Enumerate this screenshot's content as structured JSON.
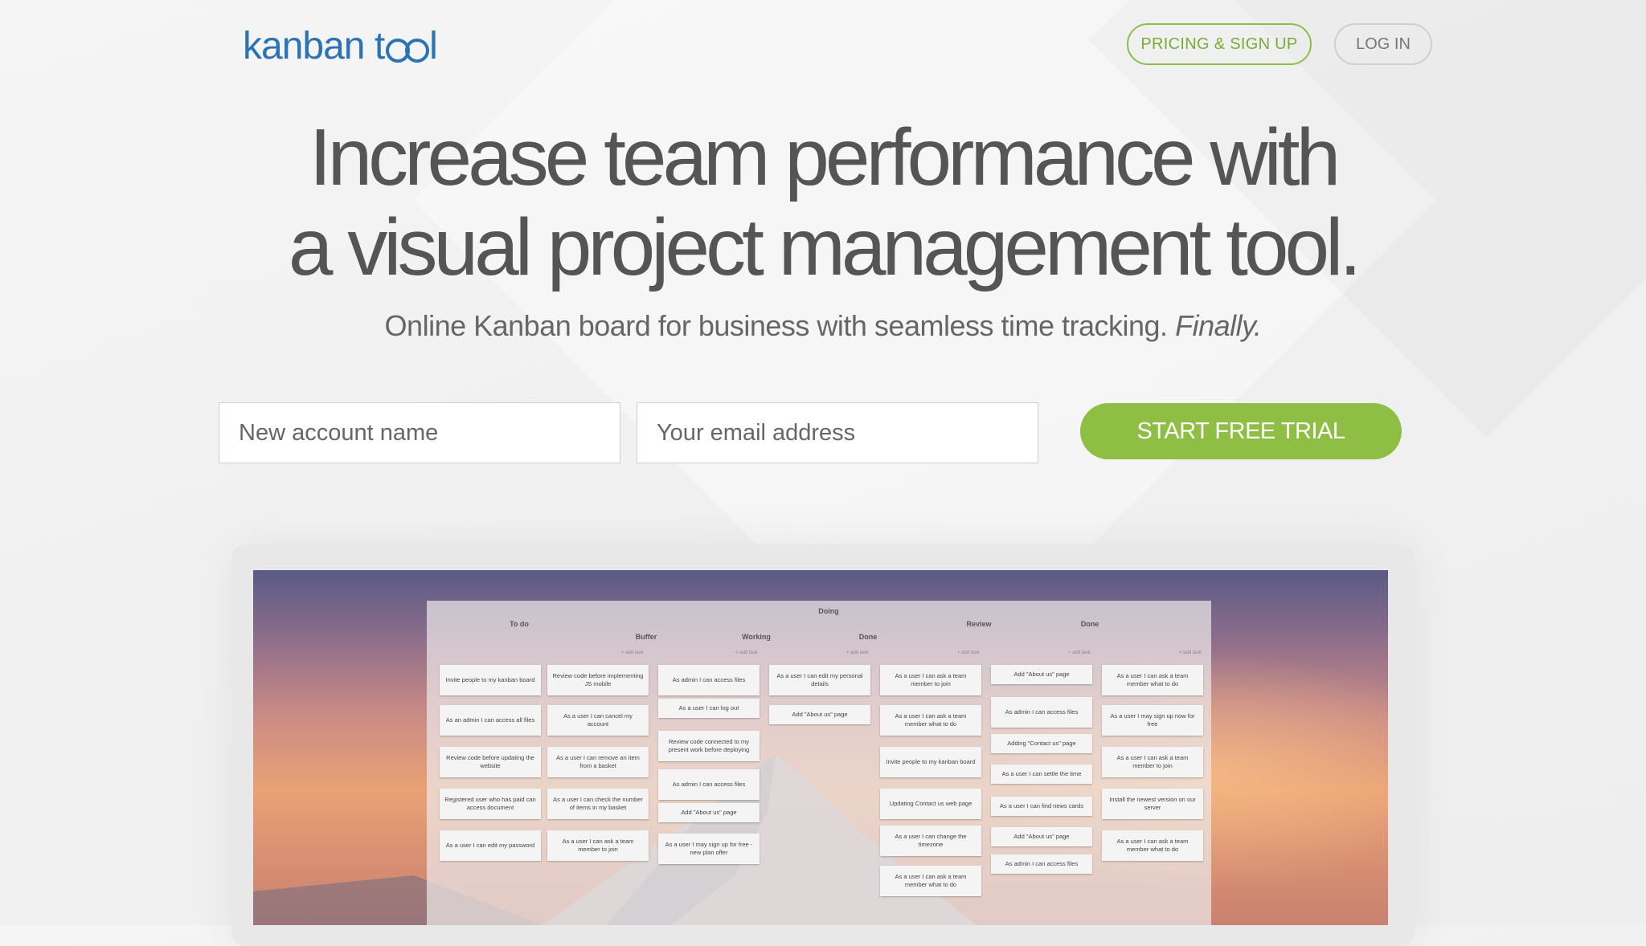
{
  "header": {
    "logo_text_a": "kanban t",
    "logo_text_b": "l",
    "pricing_label": "PRICING & SIGN UP",
    "login_label": "LOG IN"
  },
  "hero": {
    "headline_line1": "Increase team performance with",
    "headline_line2": "a visual project management tool.",
    "subline": "Online Kanban board for business with seamless time tracking.",
    "subline_emphasis": "Finally."
  },
  "signup": {
    "account_placeholder": "New account name",
    "email_placeholder": "Your email address",
    "trial_label": "START FREE TRIAL"
  },
  "colors": {
    "brand_blue": "#2a73b4",
    "accent_green": "#8fbe45"
  },
  "board": {
    "doing_label": "Doing",
    "add_task": "+ add task",
    "columns": [
      "To do",
      "Buffer",
      "Working",
      "Done",
      "Review",
      "Done"
    ],
    "cards": [
      "Invite people to my kanban board",
      "Review code before implementing JS mobile",
      "As an admin I can access all files",
      "As a user I can cancel my account",
      "Review code before updating the website",
      "As a user I can remove an item from a basket",
      "Registered user who has paid can access document",
      "As a user I can check the number of items in my basket",
      "As a user I can edit my password",
      "As a user I can ask a team member to join",
      "As admin I can access files",
      "As a user I can log out",
      "Review code connected to my present work before deploying",
      "As admin I can access files",
      "Add \"About us\" page",
      "As a user I may sign up for free - new plan offer",
      "As a user I can edit my personal details",
      "Add \"About us\" page",
      "As a user I can ask a team member to join",
      "As a user I can ask a team member what to do",
      "Invite people to my kanban board",
      "Updating Contact us web page",
      "As a user I can change the timezone",
      "As a user I can ask a team member what to do",
      "Add \"About us\" page",
      "As admin I can access files",
      "Adding \"Contact us\" page",
      "As a user I can settle the time",
      "As a user I can find news cards",
      "Add \"About us\" page",
      "As admin I can access files",
      "As a user I can ask a team member what to do",
      "As a user I may sign up now for free",
      "As a user I can ask a team member to join",
      "Install the newest version on our server",
      "As a user I can ask a team member what to do"
    ]
  }
}
